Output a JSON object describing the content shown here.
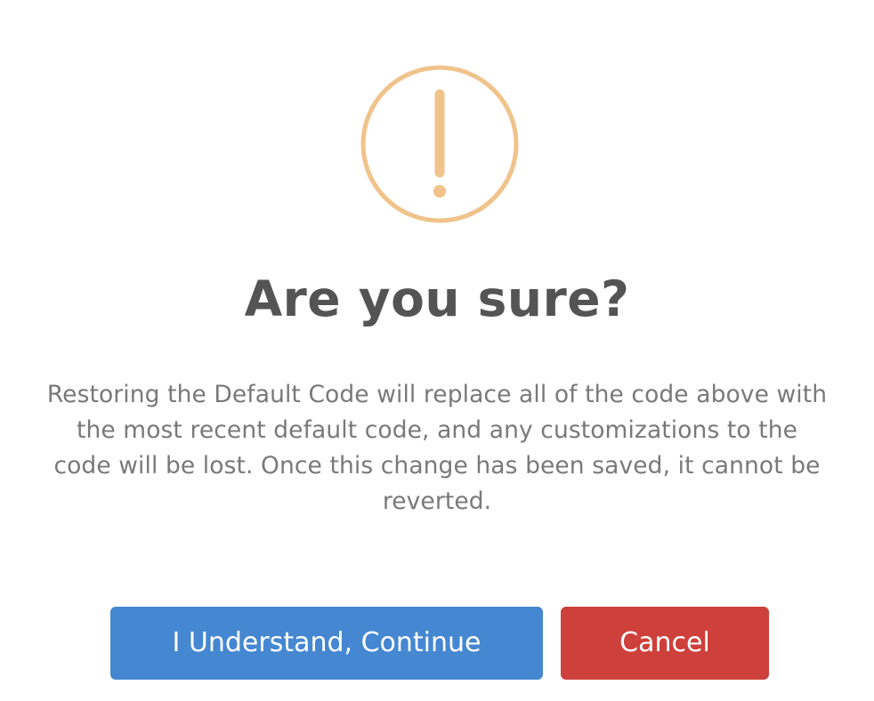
{
  "dialog": {
    "icon": "warning-exclamation-icon",
    "icon_color": "#f0c38b",
    "title": "Are you sure?",
    "message": "Restoring the Default Code will replace all of the code above with the most recent default code, and any customizations to the code will be lost. Once this change has been saved, it cannot be reverted.",
    "confirm_label": "I Understand, Continue",
    "cancel_label": "Cancel",
    "confirm_color": "#4587d1",
    "cancel_color": "#ce403b"
  }
}
